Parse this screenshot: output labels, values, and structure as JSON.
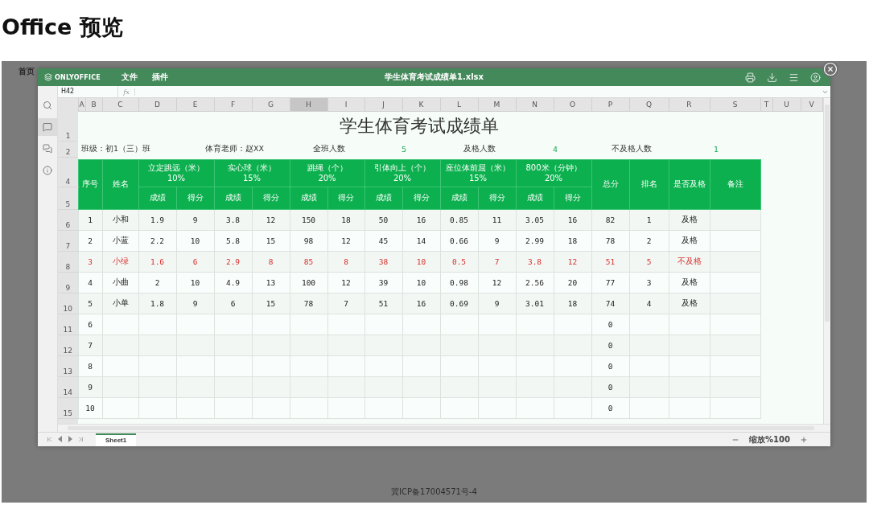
{
  "page_title": "Office 预览",
  "backdrop": {
    "nav_item": "首页",
    "footer": "冀ICP备17004571号-4"
  },
  "viewer": {
    "app_name": "ONLYOFFICE",
    "menu": [
      "文件",
      "插件"
    ],
    "file_name": "学生体育考试成绩单1.xlsx"
  },
  "sidebar": [
    {
      "kind": "search",
      "selected": false
    },
    {
      "kind": "comment",
      "selected": true
    },
    {
      "kind": "chat",
      "selected": false
    },
    {
      "kind": "info",
      "selected": false
    }
  ],
  "formula_bar": {
    "cell_ref": "H42",
    "fx": "fx"
  },
  "columns": [
    {
      "label": "A",
      "selected": false
    },
    {
      "label": "B",
      "selected": false
    },
    {
      "label": "C",
      "selected": false
    },
    {
      "label": "D",
      "selected": false
    },
    {
      "label": "E",
      "selected": false
    },
    {
      "label": "F",
      "selected": false
    },
    {
      "label": "G",
      "selected": false
    },
    {
      "label": "H",
      "selected": true
    },
    {
      "label": "I",
      "selected": false
    },
    {
      "label": "J",
      "selected": false
    },
    {
      "label": "K",
      "selected": false
    },
    {
      "label": "L",
      "selected": false
    },
    {
      "label": "M",
      "selected": false
    },
    {
      "label": "N",
      "selected": false
    },
    {
      "label": "O",
      "selected": false
    },
    {
      "label": "P",
      "selected": false
    },
    {
      "label": "Q",
      "selected": false
    },
    {
      "label": "R",
      "selected": false
    },
    {
      "label": "S",
      "selected": false
    },
    {
      "label": "T",
      "selected": false
    },
    {
      "label": "U",
      "selected": false
    },
    {
      "label": "V",
      "selected": false
    }
  ],
  "row_numbers": [
    "1",
    "2",
    "4",
    "5",
    "6",
    "7",
    "8",
    "9",
    "10",
    "11",
    "12",
    "13",
    "14",
    "15"
  ],
  "sheet": {
    "title": "学生体育考试成绩单",
    "info": [
      {
        "kind": "label",
        "text": "班级：初1（三）班"
      },
      {
        "kind": "label",
        "text": "体育老师：赵XX"
      },
      {
        "kind": "label",
        "text": "全班人数"
      },
      {
        "kind": "value",
        "text": "5"
      },
      {
        "kind": "label",
        "text": "及格人数"
      },
      {
        "kind": "value",
        "text": "4"
      },
      {
        "kind": "label",
        "text": "不及格人数"
      },
      {
        "kind": "value",
        "text": "1"
      }
    ],
    "lead_headers": [
      "序号",
      "姓名"
    ],
    "groups": [
      {
        "name": "立定跳远（米）",
        "weight": "10%"
      },
      {
        "name": "实心球（米）",
        "weight": "15%"
      },
      {
        "name": "跳绳（个）",
        "weight": "20%"
      },
      {
        "name": "引体向上（个）",
        "weight": "20%"
      },
      {
        "name": "座位体前屈（米）",
        "weight": "15%"
      },
      {
        "name": "800米（分钟）",
        "weight": "20%"
      }
    ],
    "tail_headers": [
      "总分",
      "排名",
      "是否及格",
      "备注"
    ],
    "sub_headers": [
      "成绩",
      "得分",
      "成绩",
      "得分",
      "成绩",
      "得分",
      "成绩",
      "得分",
      "成绩",
      "得分",
      "成绩",
      "得分"
    ],
    "rows": [
      {
        "no": "1",
        "name": "小和",
        "scores": [
          "1.9",
          "9",
          "3.8",
          "12",
          "150",
          "18",
          "50",
          "16",
          "0.85",
          "11",
          "3.05",
          "16"
        ],
        "total": "82",
        "rank": "1",
        "result": "及格",
        "failed": false
      },
      {
        "no": "2",
        "name": "小蓝",
        "scores": [
          "2.2",
          "10",
          "5.8",
          "15",
          "98",
          "12",
          "45",
          "14",
          "0.66",
          "9",
          "2.99",
          "18"
        ],
        "total": "78",
        "rank": "2",
        "result": "及格",
        "failed": false
      },
      {
        "no": "3",
        "name": "小绿",
        "scores": [
          "1.6",
          "6",
          "2.9",
          "8",
          "85",
          "8",
          "38",
          "10",
          "0.5",
          "7",
          "3.8",
          "12"
        ],
        "total": "51",
        "rank": "5",
        "result": "不及格",
        "failed": true
      },
      {
        "no": "4",
        "name": "小曲",
        "scores": [
          "2",
          "10",
          "4.9",
          "13",
          "100",
          "12",
          "39",
          "10",
          "0.98",
          "12",
          "2.56",
          "20"
        ],
        "total": "77",
        "rank": "3",
        "result": "及格",
        "failed": false
      },
      {
        "no": "5",
        "name": "小单",
        "scores": [
          "1.8",
          "9",
          "6",
          "15",
          "78",
          "7",
          "51",
          "16",
          "0.69",
          "9",
          "3.01",
          "18"
        ],
        "total": "74",
        "rank": "4",
        "result": "及格",
        "failed": false
      },
      {
        "no": "6",
        "total": "0",
        "failed": false
      },
      {
        "no": "7",
        "total": "0",
        "failed": false
      },
      {
        "no": "8",
        "total": "0",
        "failed": false
      },
      {
        "no": "9",
        "total": "0",
        "failed": false
      },
      {
        "no": "10",
        "total": "0",
        "failed": false
      }
    ]
  },
  "sheet_tabs": [
    {
      "label": "Sheet1",
      "selected": true
    }
  ],
  "zoom_label": "缩放%100"
}
